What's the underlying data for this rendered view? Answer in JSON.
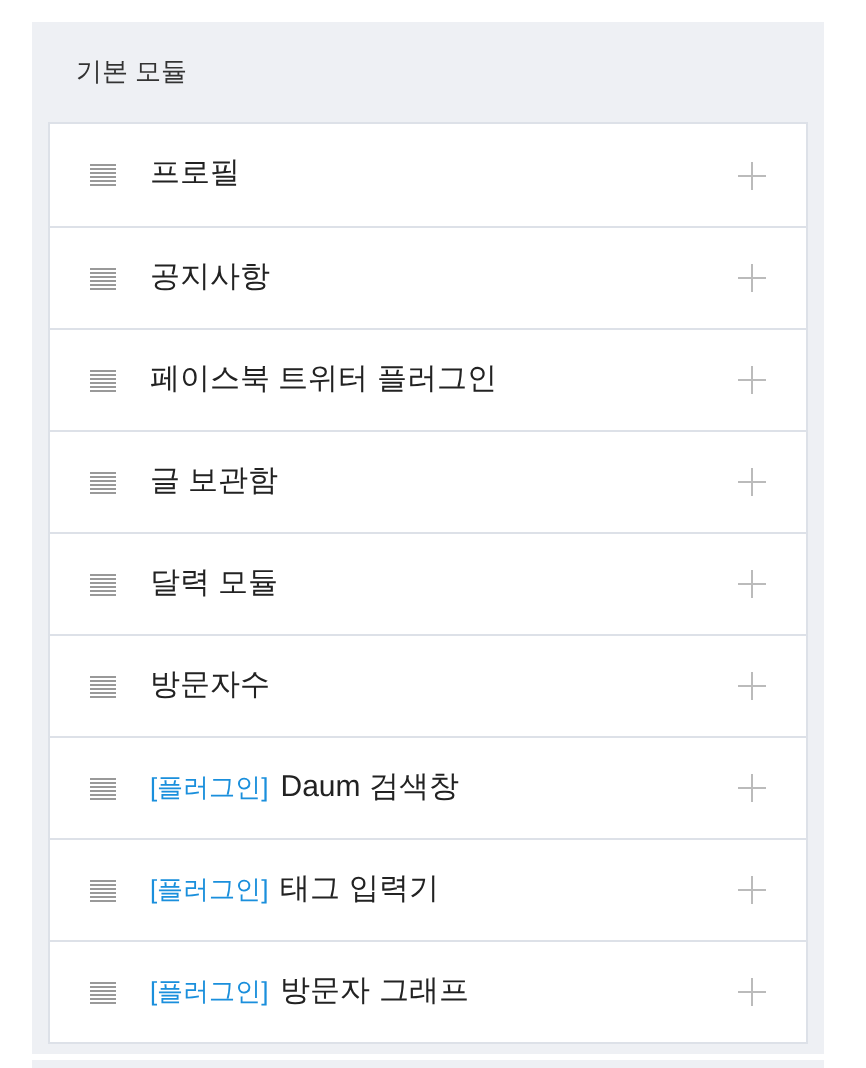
{
  "panel": {
    "title": "기본 모듈"
  },
  "modules": [
    {
      "label": "프로필"
    },
    {
      "label": "공지사항"
    },
    {
      "label": "페이스북 트위터 플러그인"
    },
    {
      "label": "글 보관함"
    },
    {
      "label": "달력 모듈"
    },
    {
      "label": "방문자수"
    },
    {
      "tag": "[플러그인]",
      "label": "Daum 검색창"
    },
    {
      "tag": "[플러그인]",
      "label": "태그 입력기"
    },
    {
      "tag": "[플러그인]",
      "label": "방문자 그래프"
    }
  ]
}
